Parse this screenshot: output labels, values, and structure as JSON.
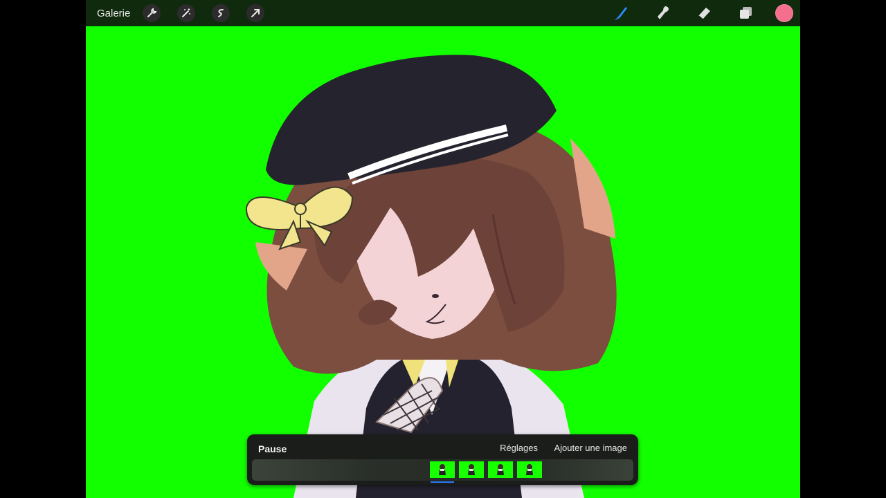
{
  "toolbar": {
    "gallery_label": "Galerie",
    "left_tools": [
      "wrench-icon",
      "magic-wand-icon",
      "selection-icon",
      "transform-arrow-icon"
    ],
    "right_tools": [
      "brush-icon",
      "smudge-icon",
      "eraser-icon",
      "layers-icon"
    ],
    "current_color": "#f36f8d"
  },
  "canvas": {
    "background": "#12ff00"
  },
  "animation": {
    "pause_label": "Pause",
    "settings_label": "Réglages",
    "add_frame_label": "Ajouter une image",
    "frame_count": 4,
    "selected_frame": 1
  }
}
